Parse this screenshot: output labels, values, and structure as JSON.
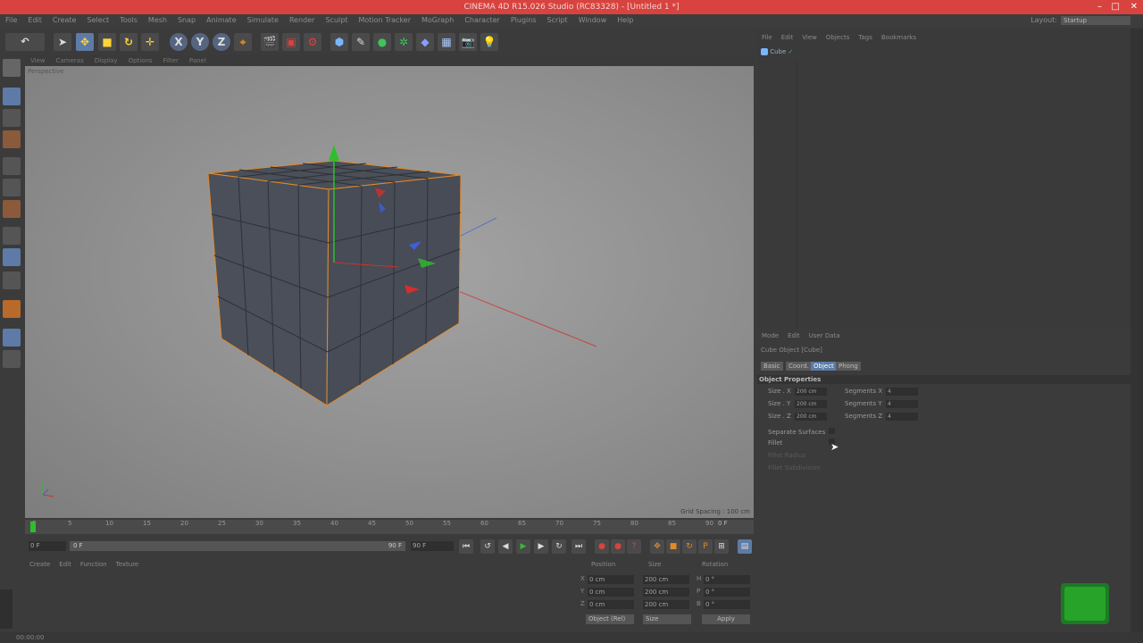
{
  "window": {
    "title": "CINEMA 4D R15.026 Studio (RC83328) - [Untitled 1 *]",
    "controls": [
      "–",
      "□",
      "✕"
    ]
  },
  "menubar": {
    "items": [
      "File",
      "Edit",
      "Create",
      "Select",
      "Tools",
      "Mesh",
      "Snap",
      "Animate",
      "Simulate",
      "Render",
      "Sculpt",
      "Motion Tracker",
      "MoGraph",
      "Character",
      "Plugins",
      "Script",
      "Window",
      "Help"
    ],
    "layout_label": "Layout:",
    "layout_value": "Startup"
  },
  "toolbar": {
    "axis_x": "X",
    "axis_y": "Y",
    "axis_z": "Z"
  },
  "viewport": {
    "menu": [
      "View",
      "Cameras",
      "Display",
      "Options",
      "Filter",
      "Panel"
    ],
    "camera_label": "Perspective",
    "grid_spacing": "Grid Spacing : 100 cm"
  },
  "timeline": {
    "ticks": [
      "0",
      "5",
      "10",
      "15",
      "20",
      "25",
      "30",
      "35",
      "40",
      "45",
      "50",
      "55",
      "60",
      "65",
      "70",
      "75",
      "80",
      "85",
      "90"
    ],
    "end_frame": "0 F"
  },
  "transport": {
    "start_field": "0 F",
    "end_field": "90 F",
    "range_start": "0 F",
    "range_end": "90 F"
  },
  "material_manager": {
    "menu": [
      "Create",
      "Edit",
      "Function",
      "Texture"
    ]
  },
  "coordinates": {
    "headers": [
      "Position",
      "Size",
      "Rotation"
    ],
    "rows": [
      {
        "axis": "X",
        "pos": "0 cm",
        "size": "200 cm",
        "rot_axis": "H",
        "rot": "0 °"
      },
      {
        "axis": "Y",
        "pos": "0 cm",
        "size": "200 cm",
        "rot_axis": "P",
        "rot": "0 °"
      },
      {
        "axis": "Z",
        "pos": "0 cm",
        "size": "200 cm",
        "rot_axis": "B",
        "rot": "0 °"
      }
    ],
    "mode_select": "Object (Rel)",
    "size_select": "Size",
    "apply_label": "Apply"
  },
  "object_manager": {
    "menu": [
      "File",
      "Edit",
      "View",
      "Objects",
      "Tags",
      "Bookmarks"
    ],
    "objects": [
      {
        "name": "Cube"
      }
    ]
  },
  "attribute_manager": {
    "menu": [
      "Mode",
      "Edit",
      "User Data"
    ],
    "title": "Cube Object [Cube]",
    "tabs": [
      "Basic",
      "Coord.",
      "Object",
      "Phong"
    ],
    "active_tab": "Object",
    "section": "Object Properties",
    "params": [
      {
        "label": "Size . X",
        "value": "200 cm",
        "seg_label": "Segments X",
        "seg_value": "4"
      },
      {
        "label": "Size . Y",
        "value": "200 cm",
        "seg_label": "Segments Y",
        "seg_value": "4"
      },
      {
        "label": "Size . Z",
        "value": "200 cm",
        "seg_label": "Segments Z",
        "seg_value": "4"
      }
    ],
    "separate_surfaces": "Separate Surfaces",
    "fillet": "Fillet",
    "fillet_radius": "Fillet Radius",
    "fillet_subdivision": "Fillet Subdivision"
  },
  "status": {
    "text": "00:00:00"
  },
  "colors": {
    "titlebar": "#d8433f",
    "selection_orange": "#e38a2a",
    "axis_x": "#d03030",
    "axis_y": "#2fbe2f",
    "axis_z": "#3f5fd8",
    "active_tab": "#5d7ba6"
  }
}
